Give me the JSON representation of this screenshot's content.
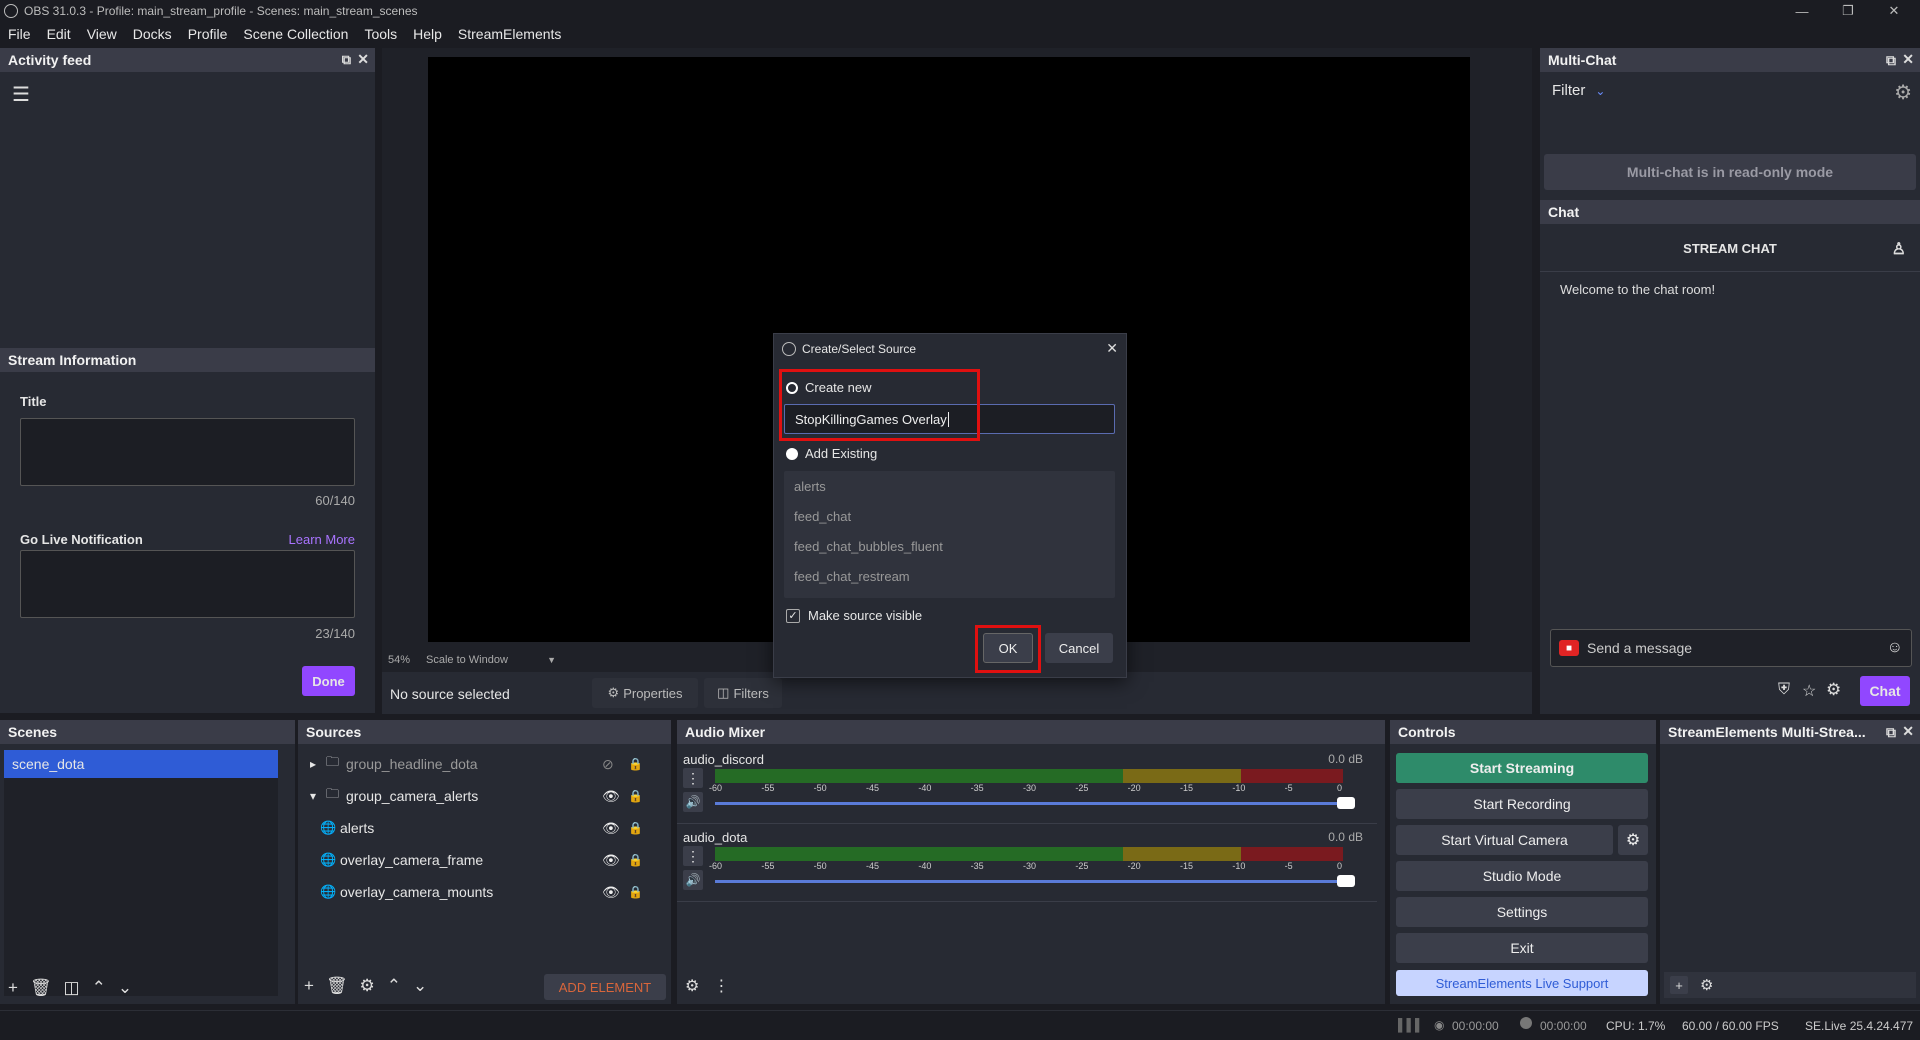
{
  "window": {
    "title": "OBS 31.0.3 - Profile: main_stream_profile - Scenes: main_stream_scenes"
  },
  "menu": [
    "File",
    "Edit",
    "View",
    "Docks",
    "Profile",
    "Scene Collection",
    "Tools",
    "Help",
    "StreamElements"
  ],
  "activity_feed": {
    "title": "Activity feed"
  },
  "stream_info": {
    "title": "Stream Information",
    "title_label": "Title",
    "title_count": "60/140",
    "notif_label": "Go Live Notification",
    "learn_more": "Learn More",
    "notif_count": "23/140",
    "done": "Done"
  },
  "preview": {
    "zoom": "54%",
    "scale": "Scale to Window",
    "no_source": "No source selected",
    "properties": "Properties",
    "filters": "Filters"
  },
  "multichat": {
    "title": "Multi-Chat",
    "filter": "Filter",
    "readonly": "Multi-chat is in read-only mode",
    "chat_title": "Chat",
    "stream_chat": "STREAM CHAT",
    "welcome": "Welcome to the chat room!",
    "send_placeholder": "Send a message",
    "chat_btn": "Chat"
  },
  "dialog": {
    "title": "Create/Select Source",
    "create_new": "Create new",
    "input_value": "StopKillingGames Overlay",
    "add_existing": "Add Existing",
    "existing": [
      "alerts",
      "feed_chat",
      "feed_chat_bubbles_fluent",
      "feed_chat_restream"
    ],
    "make_visible": "Make source visible",
    "ok": "OK",
    "cancel": "Cancel"
  },
  "scenes": {
    "title": "Scenes",
    "items": [
      "scene_dota"
    ]
  },
  "sources": {
    "title": "Sources",
    "items": [
      {
        "name": "group_headline_dota"
      },
      {
        "name": "group_camera_alerts"
      },
      {
        "name": "alerts"
      },
      {
        "name": "overlay_camera_frame"
      },
      {
        "name": "overlay_camera_mounts"
      }
    ],
    "add_element": "ADD ELEMENT"
  },
  "mixer": {
    "title": "Audio Mixer",
    "channels": [
      {
        "name": "audio_discord",
        "db": "0.0 dB"
      },
      {
        "name": "audio_dota",
        "db": "0.0 dB"
      }
    ],
    "ticks": [
      "-60",
      "-55",
      "-50",
      "-45",
      "-40",
      "-35",
      "-30",
      "-25",
      "-20",
      "-15",
      "-10",
      "-5",
      "0"
    ]
  },
  "controls": {
    "title": "Controls",
    "start_streaming": "Start Streaming",
    "start_recording": "Start Recording",
    "start_virtual": "Start Virtual Camera",
    "studio_mode": "Studio Mode",
    "settings": "Settings",
    "exit": "Exit",
    "support": "StreamElements Live Support"
  },
  "se_dock": {
    "title": "StreamElements Multi-Strea..."
  },
  "status": {
    "rec_time": "00:00:00",
    "stream_time": "00:00:00",
    "cpu": "CPU: 1.7%",
    "fps": "60.00 / 60.00 FPS",
    "version": "SE.Live 25.4.24.477"
  },
  "colors": {
    "accent_purple": "#9147ff",
    "stream_green": "#2e8b6a",
    "scene_selected": "#2f5cd6",
    "highlight_red": "#e01010"
  }
}
